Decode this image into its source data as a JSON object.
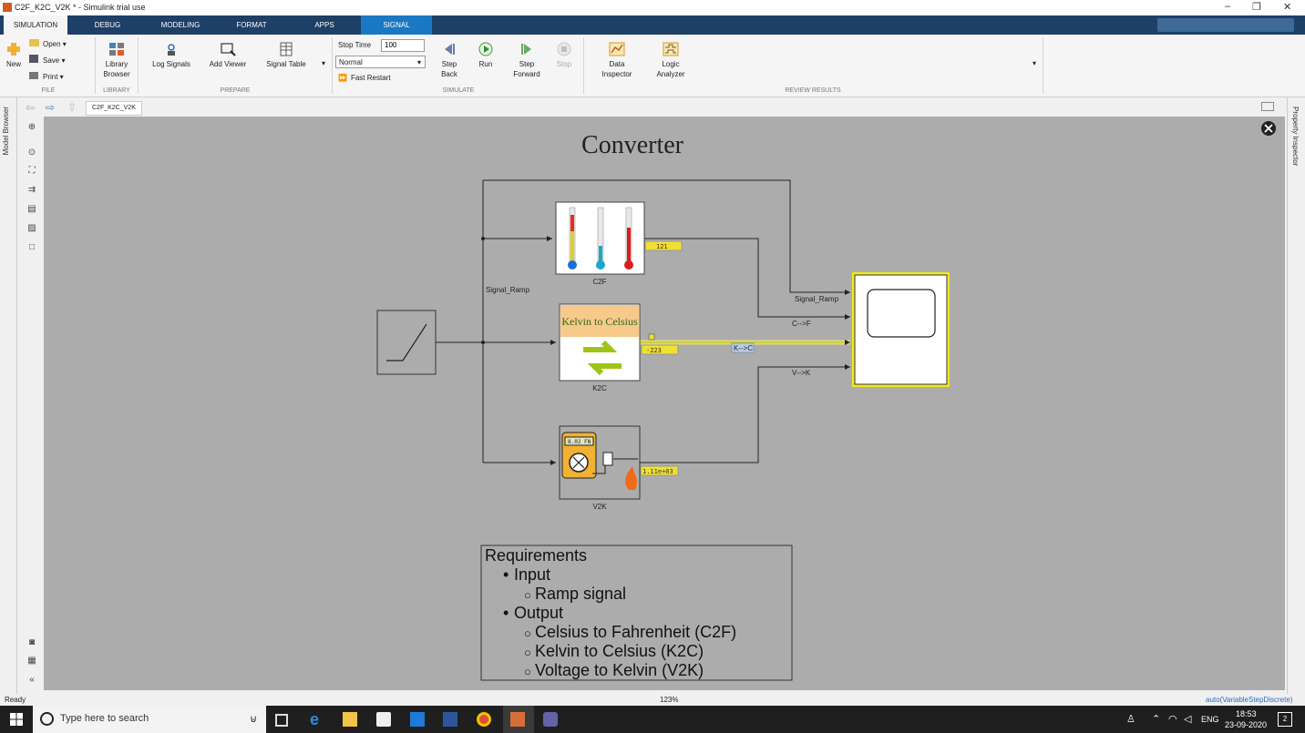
{
  "window": {
    "title": "C2F_K2C_V2K * - Simulink trial use",
    "controls": [
      "–",
      "❐",
      "✕"
    ]
  },
  "tabs": [
    {
      "label": "SIMULATION"
    },
    {
      "label": "DEBUG"
    },
    {
      "label": "MODELING"
    },
    {
      "label": "FORMAT"
    },
    {
      "label": "APPS"
    },
    {
      "label": "SIGNAL"
    }
  ],
  "toolstrip": {
    "file": {
      "open": "Open",
      "save": "Save",
      "print": "Print",
      "new": "New",
      "label": "FILE"
    },
    "library": {
      "browser": "Library Browser",
      "label": "LIBRARY"
    },
    "prepare": {
      "log_signals": "Log Signals",
      "add_viewer": "Add Viewer",
      "signal_table": "Signal Table",
      "label": "PREPARE"
    },
    "simulate": {
      "stop_time_label": "Stop Time",
      "stop_time_value": "100",
      "mode": "Normal",
      "fast_restart": "Fast Restart",
      "step_back": "Step Back",
      "run": "Run",
      "step_forward": "Step Forward",
      "stop": "Stop",
      "label": "SIMULATE"
    },
    "review": {
      "data_inspector": "Data Inspector",
      "logic_analyzer": "Logic Analyzer",
      "label": "REVIEW RESULTS"
    }
  },
  "explorer": {
    "breadcrumb": "C2F_K2C_V2K"
  },
  "side": {
    "model_browser": "Model Browser",
    "property_inspector": "Property Inspector"
  },
  "diagram": {
    "title": "Converter",
    "blocks": {
      "c2f": "C2F",
      "k2c": "K2C",
      "k2c_banner": "Kelvin to Celsius",
      "v2k": "V2K",
      "meter_reading": "8.02 FN"
    },
    "displays": {
      "c2f": "121",
      "k2c": "-223",
      "v2k": "1.11e+03"
    },
    "signals": {
      "ramp": "Signal_Ramp",
      "ramp_in": "Signal_Ramp",
      "c2f": "C-->F",
      "k2c": "K-->C",
      "v2k": "V-->K"
    },
    "requirements": {
      "heading": "Requirements",
      "input": "Input",
      "input_item": "Ramp signal",
      "output": "Output",
      "output_items": [
        "Celsius to Fahrenheit (C2F)",
        "Kelvin to Celsius (K2C)",
        "Voltage to Kelvin (V2K)"
      ]
    }
  },
  "status": {
    "left": "Ready",
    "zoom": "123%",
    "solver": "auto(VariableStepDiscrete)"
  },
  "taskbar": {
    "search_placeholder": "Type here to search",
    "lang": "ENG",
    "time": "18:53",
    "date": "23-09-2020",
    "notif_count": "2"
  }
}
